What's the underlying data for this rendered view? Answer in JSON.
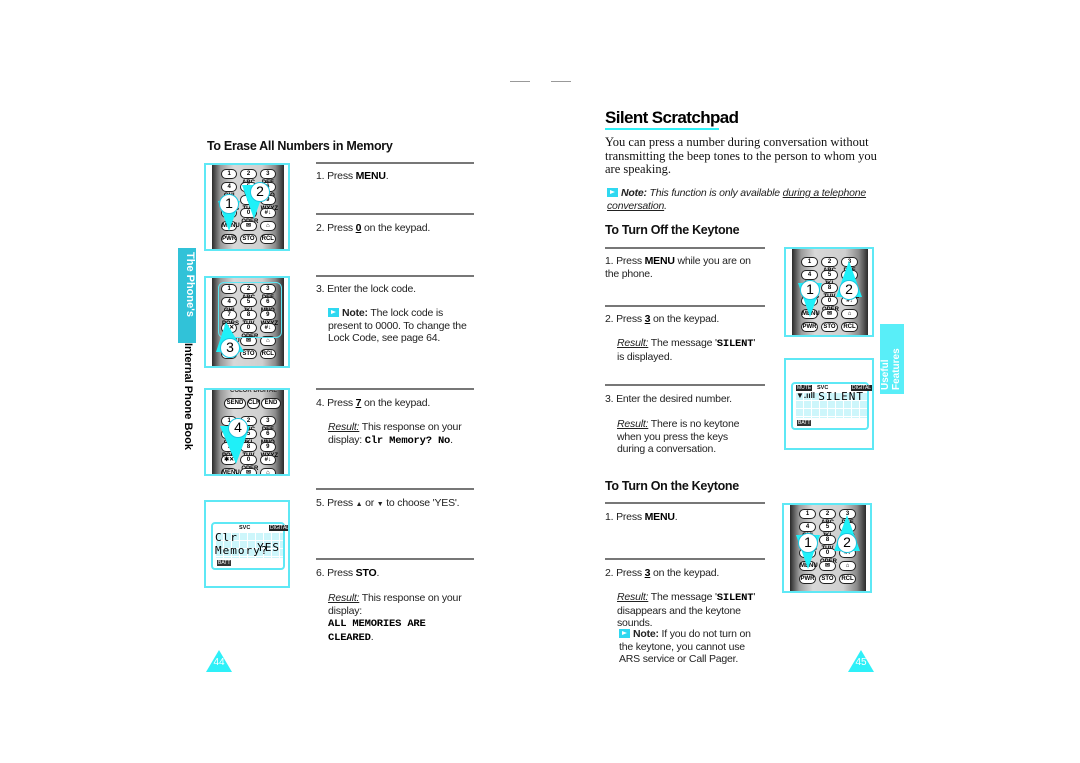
{
  "header": {
    "dash_left": "—",
    "dash_right": "—"
  },
  "left_page": {
    "side_tab": "The Phone's",
    "side_label": "Internal Phone Book",
    "section_title": "To Erase All Numbers in Memory",
    "steps": [
      {
        "num": "1.",
        "pre": "Press ",
        "key": "MENU",
        "post": "."
      },
      {
        "num": "2.",
        "pre": "Press ",
        "key": "0",
        "post": " on the keypad."
      },
      {
        "num": "3.",
        "pre": "Enter the lock code.",
        "key": "",
        "post": ""
      },
      {
        "num": "4.",
        "pre": "Press ",
        "key": "7",
        "post": " on the keypad."
      },
      {
        "num": "5.",
        "pre": "Press ",
        "key": "",
        "post": " to choose 'YES'.",
        "up": "▲",
        "or": " or ",
        "down": "▼"
      },
      {
        "num": "6.",
        "pre": "Press ",
        "key": "STO",
        "post": "."
      }
    ],
    "note3": {
      "label": "Note:",
      "text": " The lock code is present to 0000. To change the Lock Code, see page 64."
    },
    "result4": {
      "label": "Result:",
      "text": " This response on your display: ",
      "code": "Clr Memory? No",
      "end": "."
    },
    "result6": {
      "label": "Result:",
      "text": " This response on your display:",
      "code1": "ALL MEMORIES ARE",
      "code2": "CLEARED",
      "end": "."
    },
    "lcd": {
      "svc": "SVC",
      "badge": "DIGITAL",
      "line1": "Clr Memory?",
      "line2": "YES",
      "battery": "BATT"
    },
    "callouts": [
      "1",
      "2",
      "3",
      "4"
    ],
    "phone_top_keys": [
      "SEND",
      "CLR",
      "END"
    ],
    "phone_label": "COLOR DIGITAL",
    "page_number": "44"
  },
  "right_page": {
    "title": "Silent Scratchpad",
    "intro": "You can press a number during conversation without transmitting the beep tones to the person to whom you are speaking.",
    "note": {
      "label": "Note:",
      "text": " This function is only available ",
      "link": "during a telephone conversation",
      "end": "."
    },
    "off_section": {
      "title": "To Turn Off the Keytone",
      "steps": [
        {
          "num": "1.",
          "pre": "Press ",
          "key": "MENU",
          "post": " while you are on the phone."
        },
        {
          "num": "2.",
          "pre": "Press ",
          "key": "3",
          "post": " on the keypad."
        },
        {
          "num": "3.",
          "pre": "Enter the desired number.",
          "key": "",
          "post": ""
        }
      ],
      "result2": {
        "label": "Result:",
        "text": " The message '",
        "code": "SILENT",
        "end": "' is displayed."
      },
      "result3": {
        "label": "Result:",
        "text": " There is no keytone when you press the keys during a conversation."
      }
    },
    "on_section": {
      "title": "To Turn On the Keytone",
      "steps": [
        {
          "num": "1.",
          "pre": "Press ",
          "key": "MENU",
          "post": "."
        },
        {
          "num": "2.",
          "pre": "Press ",
          "key": "3",
          "post": " on the keypad."
        }
      ],
      "result2": {
        "label": "Result:",
        "text": " The message '",
        "code": "SILENT",
        "end": "' disappears and the keytone sounds."
      },
      "note": {
        "label": "Note:",
        "text": " If you do not turn on the keytone, you cannot use ARS service or Call Pager."
      }
    },
    "lcd": {
      "mute": "MUTE",
      "svc": "SVC",
      "badge": "DIGITAL",
      "signal": "▼.ııll",
      "line1": "SILENT",
      "battery": "BATT"
    },
    "callouts": [
      "1",
      "2"
    ],
    "side_tab": "Useful Features",
    "page_number": "45"
  },
  "keypad": {
    "rows": [
      [
        "1",
        "2 ABC",
        "3 DEF"
      ],
      [
        "4 GHI",
        "5 JKL",
        "6 MNO"
      ],
      [
        "7 PQRS",
        "8 TUV",
        "9 WXYZ"
      ],
      [
        "✱✕",
        "0 OPER",
        "#↓"
      ],
      [
        "MENU",
        "✉",
        "⌂"
      ],
      [
        "PWR",
        "STO",
        "RCL"
      ]
    ]
  },
  "colors": {
    "accent": "#2ef0f8",
    "frame": "#5ee8f5",
    "tab_left": "#31c2d8",
    "rule": "#777777"
  }
}
